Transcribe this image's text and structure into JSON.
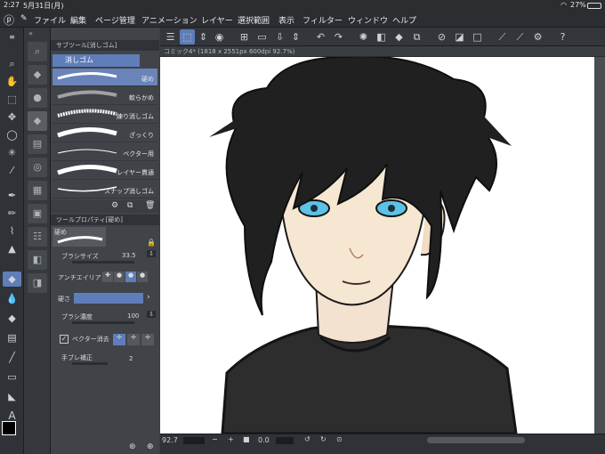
{
  "status": {
    "time": "2:27",
    "date": "5月31日(月)",
    "battery": "27%"
  },
  "menu": [
    "ファイル",
    "編集",
    "ページ管理",
    "アニメーション",
    "レイヤー",
    "選択範囲",
    "表示",
    "フィルター",
    "ウィンドウ",
    "ヘルプ"
  ],
  "subtool_panel": {
    "title": "サブツール[消しゴム]",
    "group": "消しゴム",
    "brushes": [
      "硬め",
      "軟らかめ",
      "練り消しゴム",
      "ざっくり",
      "ベクター用",
      "レイヤー貫通",
      "スナップ消しゴム"
    ],
    "selected_brush": "硬め"
  },
  "tool_property": {
    "title": "ツールプロパティ[硬め]",
    "preset": "硬め",
    "brush_size_label": "ブラシサイズ",
    "brush_size": "33.5",
    "antialias_label": "アンチエイリアス",
    "hardness_label": "硬さ",
    "density_label": "ブラシ濃度",
    "density": "100",
    "vector_erase_label": "ベクター消去",
    "vector_erase_checked": true,
    "stabilize_label": "手ブレ補正",
    "stabilize": "2"
  },
  "canvas": {
    "tab_label": "コミック4* (1818 x 2551px 600dpi 92.7%)"
  },
  "bottom": {
    "zoom": "92.7",
    "angle": "0.0"
  },
  "colors": {
    "accent": "#5f7db8",
    "panel": "#404348",
    "bar": "#2b2d31"
  }
}
